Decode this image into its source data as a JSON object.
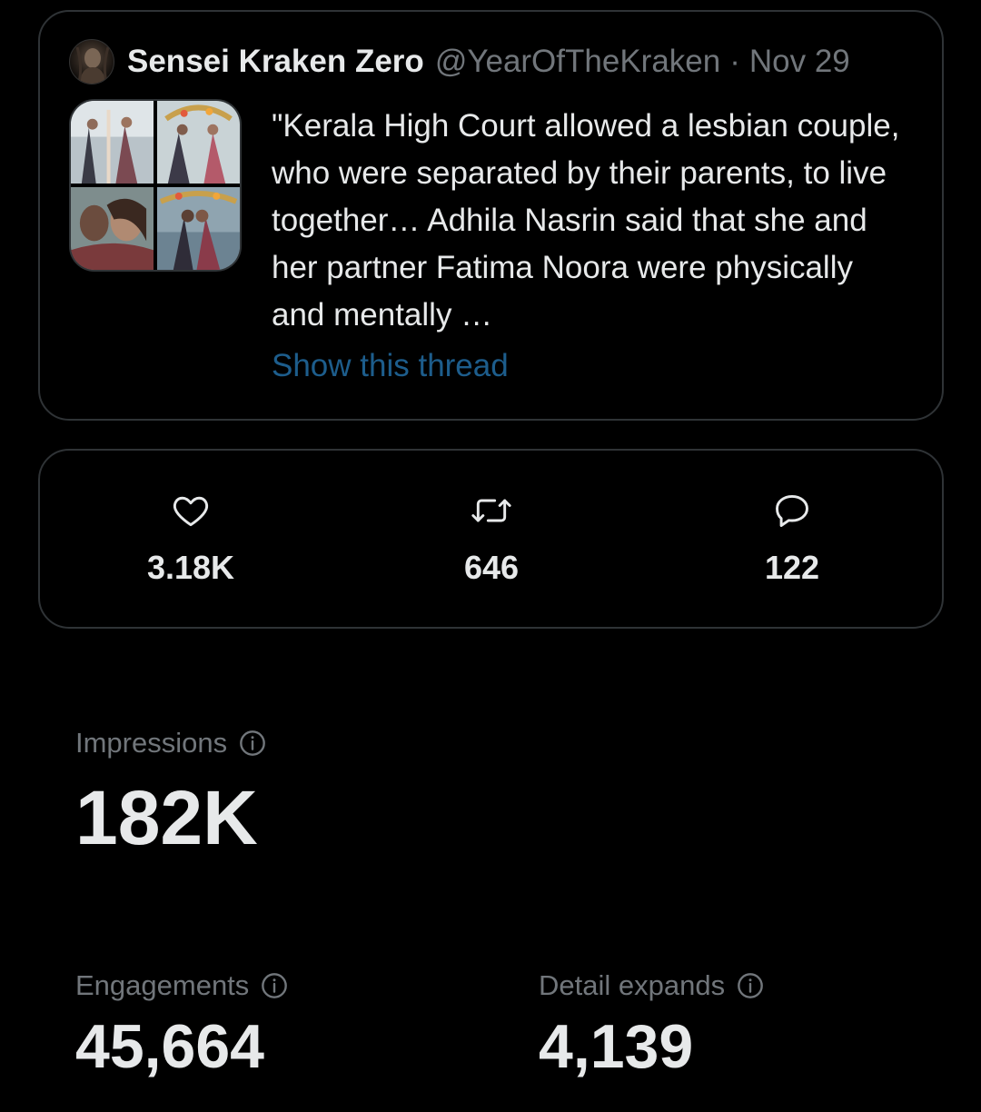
{
  "tweet": {
    "display_name": "Sensei Kraken Zero",
    "handle": "@YearOfTheKraken",
    "separator": "·",
    "date": "Nov 29",
    "text": "\"Kerala High Court allowed a lesbian couple, who were separated by their parents, to live together… Adhila Nasrin said that she and her partner Fatima Noora were physically and mentally …",
    "show_thread_label": "Show this thread",
    "media_count": 4
  },
  "stats": {
    "likes": "3.18K",
    "retweets": "646",
    "replies": "122",
    "like_icon": "heart-icon",
    "retweet_icon": "retweet-icon",
    "reply_icon": "reply-icon"
  },
  "metrics": {
    "impressions_label": "Impressions",
    "impressions_value": "182K",
    "engagements_label": "Engagements",
    "engagements_value": "45,664",
    "detail_expands_label": "Detail expands",
    "detail_expands_value": "4,139"
  },
  "colors": {
    "background": "#000000",
    "text_primary": "#e7e9ea",
    "text_secondary": "#71767b",
    "link": "#1d5d8c",
    "border": "#2f3336"
  }
}
